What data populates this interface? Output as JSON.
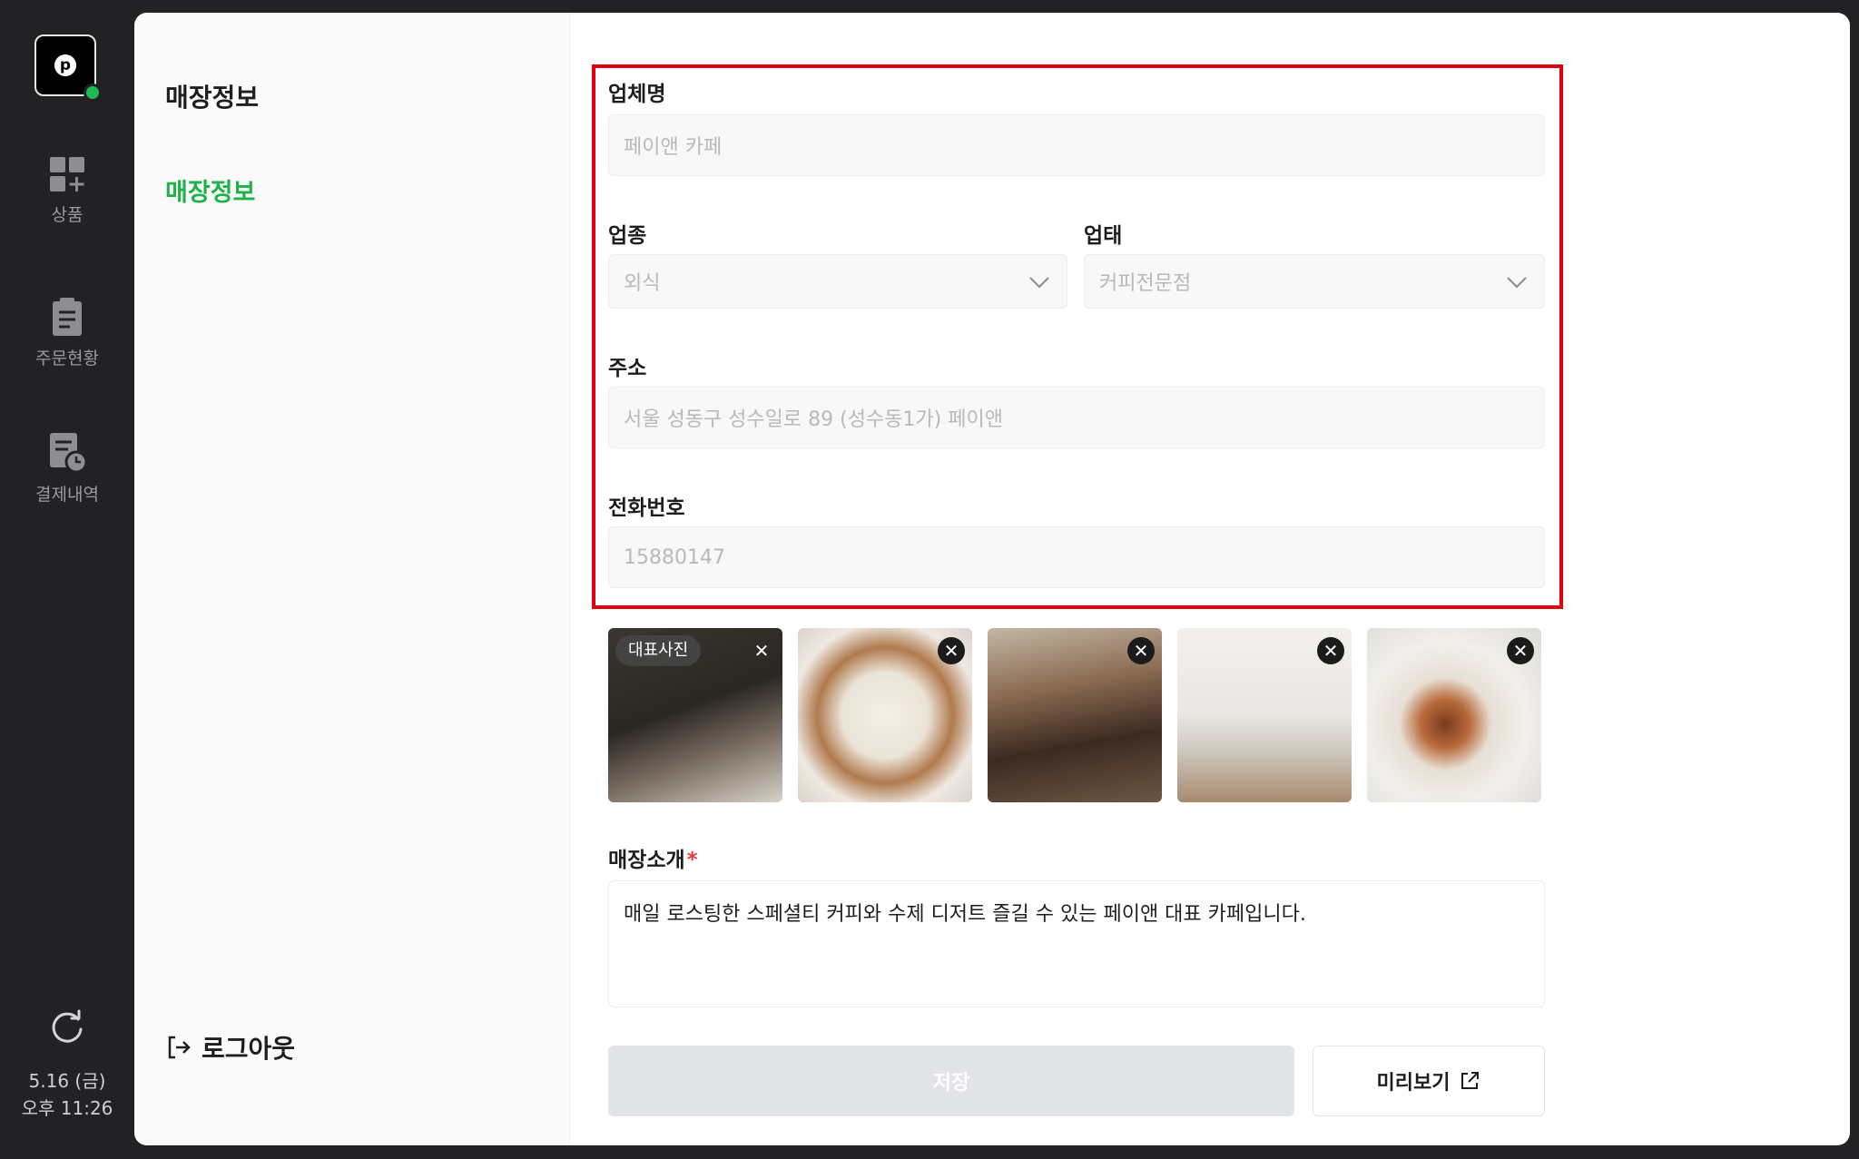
{
  "sidebar": {
    "logo_letter": "p",
    "items": [
      {
        "label": "상품",
        "icon": "grid-plus-icon"
      },
      {
        "label": "주문현황",
        "icon": "clipboard-icon"
      },
      {
        "label": "결제내역",
        "icon": "receipt-clock-icon"
      }
    ],
    "date": "5.16 (금)",
    "time": "오후 11:26"
  },
  "subnav": {
    "title": "매장정보",
    "items": [
      {
        "label": "매장정보",
        "active": true
      }
    ],
    "logout_label": "로그아웃"
  },
  "form": {
    "company": {
      "label": "업체명",
      "placeholder": "페이앤 카페"
    },
    "business_type": {
      "label": "업종",
      "value": "외식"
    },
    "business_category": {
      "label": "업태",
      "value": "커피전문점"
    },
    "address": {
      "label": "주소",
      "placeholder": "서울 성동구 성수일로 89 (성수동1가) 페이앤"
    },
    "phone": {
      "label": "전화번호",
      "placeholder": "15880147"
    },
    "photos": {
      "main_badge": "대표사진",
      "items": [
        {
          "name": "cafe-table-book-photo"
        },
        {
          "name": "dessert-plate-photo"
        },
        {
          "name": "chocolate-tart-photo"
        },
        {
          "name": "laptop-coffee-table-photo"
        },
        {
          "name": "iced-latte-glass-photo"
        }
      ]
    },
    "intro": {
      "label": "매장소개",
      "required_mark": "*",
      "value": "매일 로스팅한 스페셜티 커피와 수제 디저트 즐길 수 있는 페이앤 대표 카페입니다."
    },
    "save_label": "저장",
    "preview_label": "미리보기"
  },
  "colors": {
    "accent": "#1fb24a",
    "highlight": "#e0000f",
    "rail": "#222224"
  }
}
